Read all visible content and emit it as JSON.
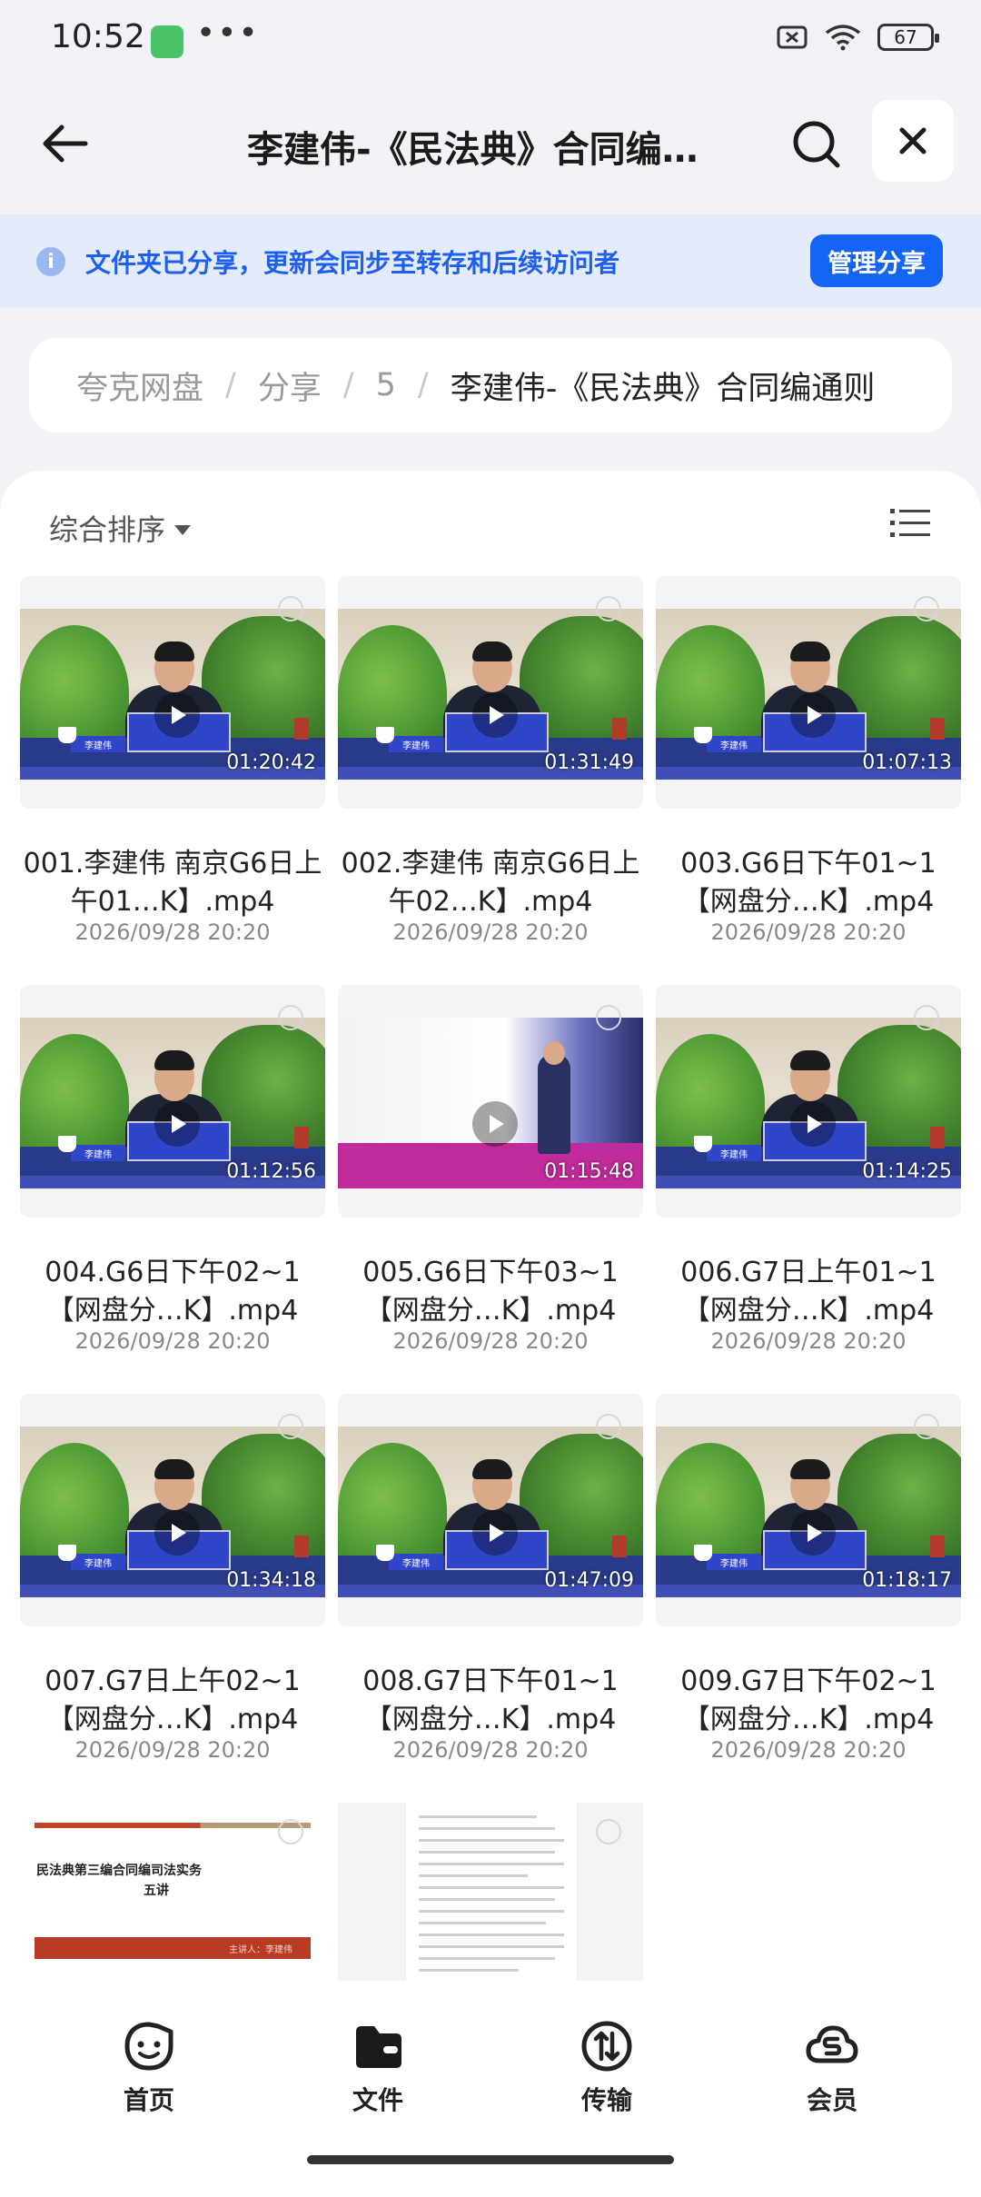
{
  "status": {
    "time": "10:52",
    "dots": "•••",
    "battery": "67"
  },
  "header": {
    "title": "李建伟-《民法典》合同编…"
  },
  "banner": {
    "message": "文件夹已分享，更新会同步至转存和后续访问者",
    "button": "管理分享"
  },
  "breadcrumb": {
    "items": [
      "夸克网盘",
      "分享",
      "5"
    ],
    "current": "李建伟-《民法典》合同编通则",
    "separator": "/"
  },
  "toolbar": {
    "sort_label": "综合排序"
  },
  "files": [
    {
      "name": "001.李建伟 南京G6日上午01…K】.mp4",
      "date": "2026/09/28 20:20",
      "duration": "01:20:42",
      "type": "video",
      "plate": "李建伟"
    },
    {
      "name": "002.李建伟 南京G6日上午02…K】.mp4",
      "date": "2026/09/28 20:20",
      "duration": "01:31:49",
      "type": "video",
      "plate": "李建伟"
    },
    {
      "name": "003.G6日下午01~1【网盘分…K】.mp4",
      "date": "2026/09/28 20:20",
      "duration": "01:07:13",
      "type": "video",
      "plate": "李建伟"
    },
    {
      "name": "004.G6日下午02~1【网盘分…K】.mp4",
      "date": "2026/09/28 20:20",
      "duration": "01:12:56",
      "type": "video",
      "plate": "李建伟"
    },
    {
      "name": "005.G6日下午03~1【网盘分…K】.mp4",
      "date": "2026/09/28 20:20",
      "duration": "01:15:48",
      "type": "stage"
    },
    {
      "name": "006.G7日上午01~1【网盘分…K】.mp4",
      "date": "2026/09/28 20:20",
      "duration": "01:14:25",
      "type": "video",
      "plate": "李建伟"
    },
    {
      "name": "007.G7日上午02~1【网盘分…K】.mp4",
      "date": "2026/09/28 20:20",
      "duration": "01:34:18",
      "type": "video",
      "plate": "李建伟"
    },
    {
      "name": "008.G7日下午01~1【网盘分…K】.mp4",
      "date": "2026/09/28 20:20",
      "duration": "01:47:09",
      "type": "video",
      "plate": "李建伟"
    },
    {
      "name": "009.G7日下午02~1【网盘分…K】.mp4",
      "date": "2026/09/28 20:20",
      "duration": "01:18:17",
      "type": "video",
      "plate": "李建伟"
    }
  ],
  "docs": [
    {
      "title_line1": "民法典第三编合同编司法实务",
      "title_line2": "五讲",
      "presenter": "主讲人：李建伟"
    },
    {
      "type": "document-page"
    }
  ],
  "nav": [
    {
      "label": "首页",
      "icon": "home-face-icon"
    },
    {
      "label": "文件",
      "icon": "folder-icon"
    },
    {
      "label": "传输",
      "icon": "transfer-icon"
    },
    {
      "label": "会员",
      "icon": "member-cloud-icon"
    }
  ]
}
